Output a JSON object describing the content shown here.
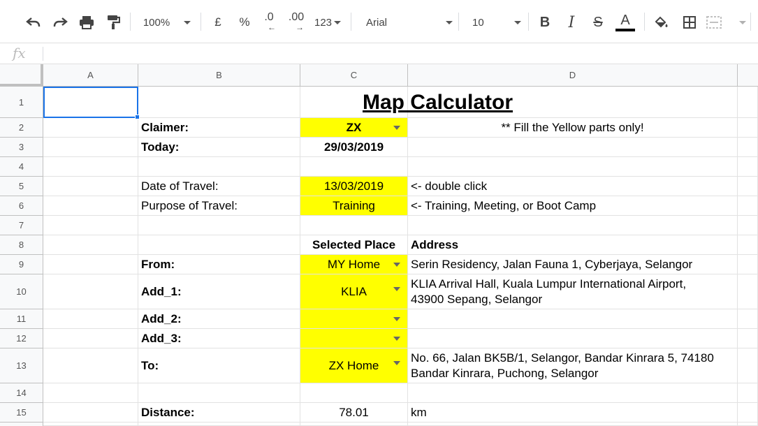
{
  "toolbar": {
    "zoom": "100%",
    "currency": "£",
    "percent": "%",
    "decrease_decimal": ".0",
    "increase_decimal": ".00",
    "more_formats": "123",
    "font": "Arial",
    "font_size": "10",
    "text_color": "#000000"
  },
  "formula_bar": {
    "fx_label": "fx",
    "content": ""
  },
  "columns": [
    "A",
    "B",
    "C",
    "D"
  ],
  "rows": [
    "1",
    "2",
    "3",
    "4",
    "5",
    "6",
    "7",
    "8",
    "9",
    "10",
    "11",
    "12",
    "13",
    "14",
    "15"
  ],
  "sheet": {
    "title": "Map Calculator",
    "claimer_label": "Claimer:",
    "claimer_value": "ZX",
    "note": "** Fill the Yellow parts only!",
    "today_label": "Today:",
    "today_value": "29/03/2019",
    "date_label": "Date of Travel:",
    "date_value": "13/03/2019",
    "date_hint": "<- double click",
    "purpose_label": "Purpose of Travel:",
    "purpose_value": "Training",
    "purpose_hint": "<- Training, Meeting, or Boot Camp",
    "selected_place_header": "Selected Place",
    "address_header": "Address",
    "from_label": "From:",
    "from_place": "MY Home",
    "from_address": "Serin Residency, Jalan Fauna 1, Cyberjaya, Selangor",
    "add1_label": "Add_1:",
    "add1_place": "KLIA",
    "add1_address_line1": "KLIA Arrival Hall, Kuala Lumpur International Airport,",
    "add1_address_line2": "43900 Sepang, Selangor",
    "add2_label": "Add_2:",
    "add2_place": "",
    "add3_label": "Add_3:",
    "add3_place": "",
    "to_label": "To:",
    "to_place": "ZX Home",
    "to_address_line1": "No. 66, Jalan BK5B/1, Selangor, Bandar Kinrara 5, 74180",
    "to_address_line2": "Bandar Kinrara, Puchong, Selangor",
    "distance_label": "Distance:",
    "distance_value": "78.01",
    "distance_unit": "km"
  },
  "colors": {
    "highlight": "#ffff00",
    "selection": "#1a73e8"
  }
}
